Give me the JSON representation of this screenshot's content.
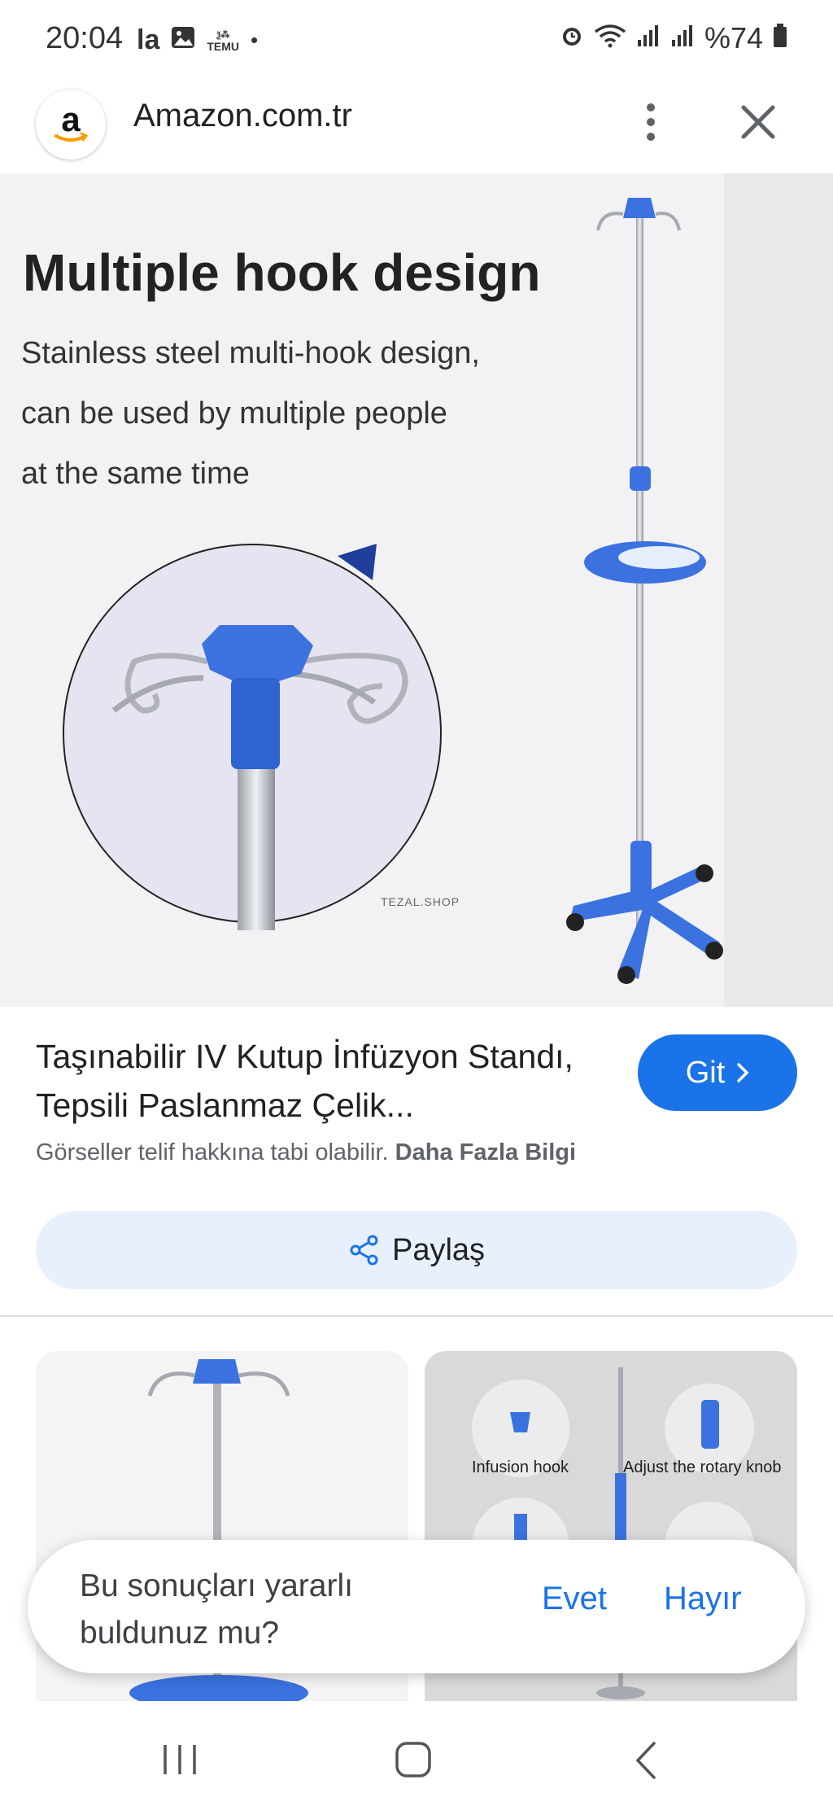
{
  "status_bar": {
    "time": "20:04",
    "battery": "%74",
    "icons": [
      "carrier-logo-icon",
      "gallery-icon",
      "temu-app-icon",
      "dot-icon",
      "alarm-icon",
      "wifi-icon",
      "signal-icon",
      "signal-icon",
      "battery-icon"
    ],
    "temu_label": "TEMU"
  },
  "toolbar": {
    "site_name": "Amazon.com.tr",
    "logo_letter": "a"
  },
  "hero": {
    "heading": "Multiple hook design",
    "lines": [
      "Stainless steel multi-hook design,",
      "can be used by multiple people",
      "at the same time"
    ],
    "watermark": "TEZAL.SHOP",
    "accent_color": "#3b72e0"
  },
  "result": {
    "title": "Taşınabilir IV Kutup İnfüzyon Standı, Tepsili Paslanmaz Çelik...",
    "go_button": "Git",
    "copyright_text": "Görseller telif hakkına tabi olabilir.",
    "more_info": "Daha Fazla Bilgi",
    "share_button": "Paylaş"
  },
  "related": {
    "thumb2_labels": [
      "Infusion hook",
      "Adjust the rotary knob"
    ]
  },
  "feedback": {
    "question": "Bu sonuçları yararlı buldunuz mu?",
    "yes": "Evet",
    "no": "Hayır"
  },
  "colors": {
    "primary": "#1a73e8",
    "share_bg": "#e8f0fe"
  }
}
